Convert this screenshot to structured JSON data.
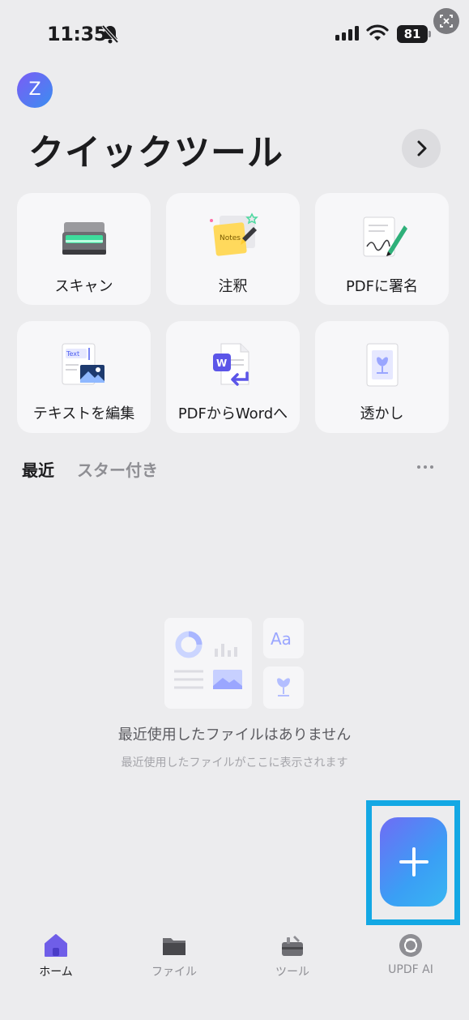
{
  "status_bar": {
    "time": "11:35",
    "battery": "81",
    "icons": [
      "bell-muted-icon",
      "signal-icon",
      "wifi-icon",
      "battery-icon",
      "live-text-icon"
    ]
  },
  "header": {
    "avatar_letter": "Z",
    "title": "クイックツール"
  },
  "quick_tools": [
    {
      "label": "スキャン",
      "icon": "scanner-icon"
    },
    {
      "label": "注釈",
      "icon": "sticky-note-icon"
    },
    {
      "label": "PDFに署名",
      "icon": "signature-icon"
    },
    {
      "label": "テキストを編集",
      "icon": "edit-text-icon"
    },
    {
      "label": "PDFからWordへ",
      "icon": "pdf-to-word-icon"
    },
    {
      "label": "透かし",
      "icon": "watermark-icon"
    }
  ],
  "tabs": {
    "recent": "最近",
    "starred": "スター付き"
  },
  "empty_state": {
    "title": "最近使用したファイルはありません",
    "subtitle": "最近使用したファイルがここに表示されます",
    "illustration_text": "Aa"
  },
  "bottom_nav": [
    {
      "label": "ホーム",
      "icon": "home-icon",
      "active": true
    },
    {
      "label": "ファイル",
      "icon": "folder-icon",
      "active": false
    },
    {
      "label": "ツール",
      "icon": "toolbox-icon",
      "active": false
    },
    {
      "label": "UPDF AI",
      "icon": "ai-icon",
      "active": false
    }
  ],
  "colors": {
    "background": "#ececee",
    "accent_purple": "#6f6cf5",
    "accent_blue": "#38b6f2",
    "highlight": "#13a8e4"
  }
}
